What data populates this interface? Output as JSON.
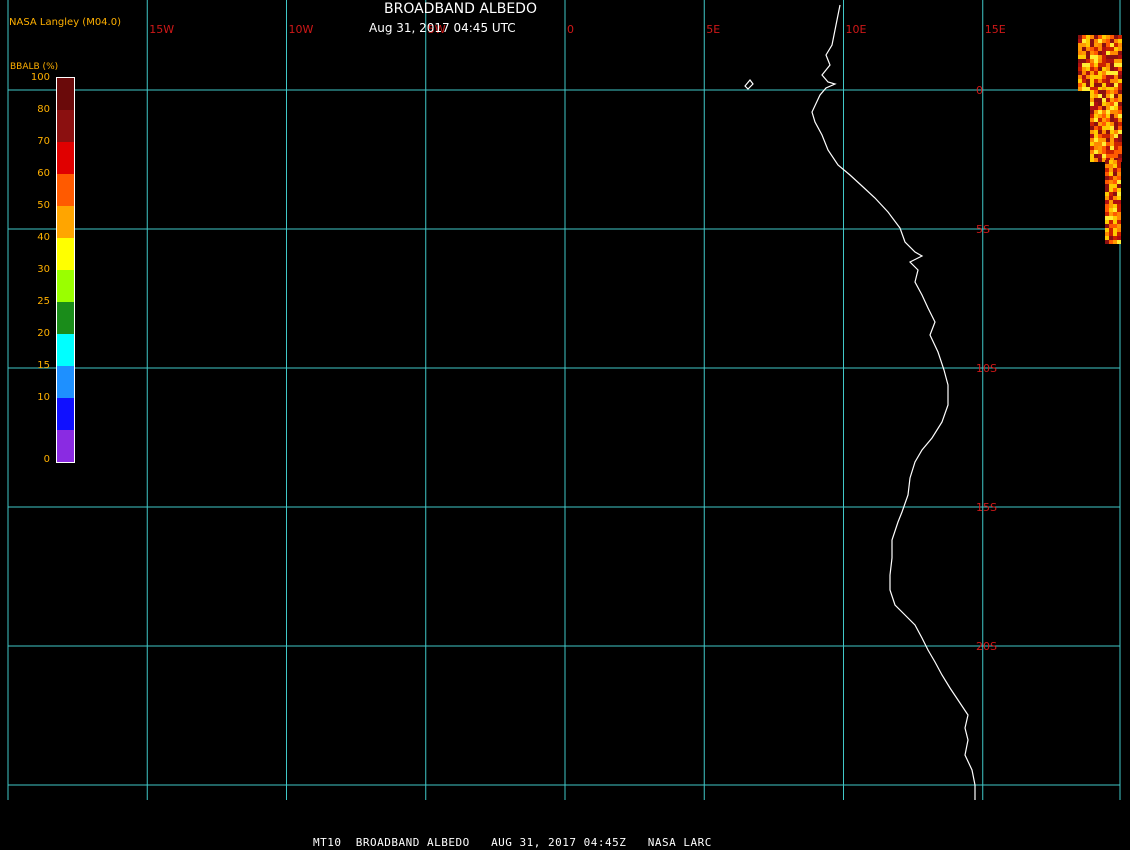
{
  "header": {
    "credit": "NASA Langley (M04.0)",
    "title": "BROADBAND ALBEDO",
    "datetime": "Aug 31, 2017 04:45 UTC"
  },
  "footer": {
    "caption": "MT10  BROADBAND ALBEDO   AUG 31, 2017 04:45Z   NASA LARC"
  },
  "map": {
    "lon_labels": [
      "15W",
      "10W",
      "5W",
      "0",
      "5E",
      "10E",
      "15E"
    ],
    "lat_labels": [
      "0",
      "5S",
      "10S",
      "15S",
      "20S"
    ],
    "lat_label_values": [
      0,
      -5,
      -10,
      -15,
      -20
    ],
    "lon_range": [
      -20,
      15
    ],
    "lat_range": [
      2,
      -25
    ],
    "grid_color": "#40c8c8",
    "label_color": "#d01818",
    "coast_color": "#ffffff"
  },
  "colorbar": {
    "title": "BBALB (%)",
    "ticks": [
      "100",
      "80",
      "70",
      "60",
      "50",
      "40",
      "30",
      "25",
      "20",
      "15",
      "10",
      "0"
    ],
    "colors": [
      "#6a0a0a",
      "#8b1010",
      "#e00000",
      "#ff5a00",
      "#ffa500",
      "#ffff00",
      "#9aff00",
      "#1a8c1a",
      "#00ffff",
      "#1e90ff",
      "#1010ff",
      "#8a2be2"
    ]
  }
}
